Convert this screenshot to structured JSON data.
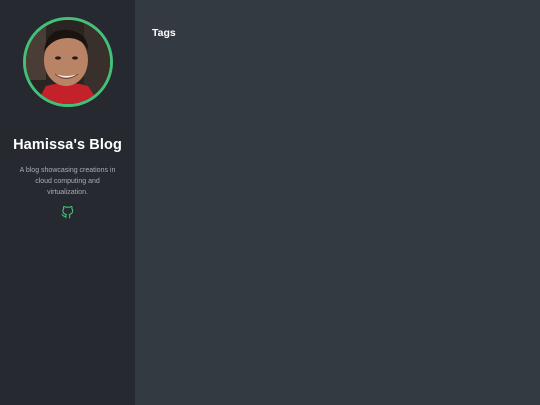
{
  "sidebar": {
    "title": "Hamissa's Blog",
    "description": "A blog showcasing creations in cloud computing and virtualization.",
    "social": [
      {
        "icon": "github-icon"
      }
    ]
  },
  "main": {
    "heading": "Tags"
  },
  "colors": {
    "accent": "#45c07a",
    "sidebar_bg": "#262a30",
    "main_bg": "#343a42"
  }
}
